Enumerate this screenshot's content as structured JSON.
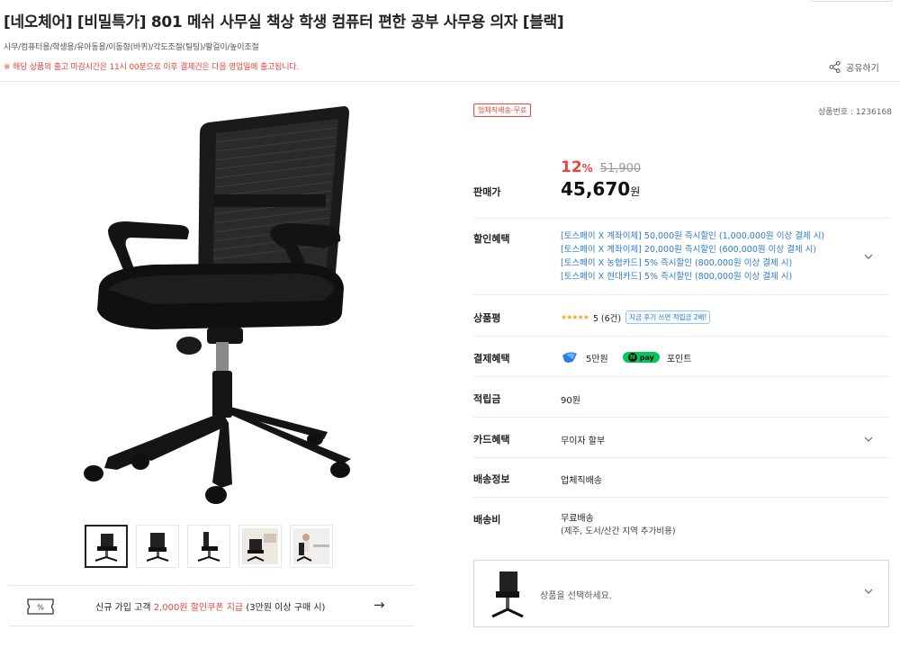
{
  "product": {
    "title": "[네오체어] [비밀특가] 801 메쉬 사무실 책상 학생 컴퓨터 편한 공부 사무용 의자 [블랙]",
    "categories": "사무/컴퓨터용/학생용/유아동용/이동형(바퀴)/각도조절(틸팅)/팔걸이/높이조절",
    "notice": "※ 해당 상품의 출고 마감시간은 11시 00분으로 이후 결제건은 다음 영업일에 출고됩니다.",
    "share_label": "공유하기",
    "badge": "업체직배송-무료",
    "product_number": "상품번호 : 1236168"
  },
  "price": {
    "label": "판매가",
    "discount_pct": "12",
    "pct_sign": "%",
    "original": "51,900",
    "sale": "45,670",
    "won": "원"
  },
  "benefits": {
    "label": "할인혜택",
    "items": [
      "[토스페이 X 계좌이체] 50,000원 즉시할인 (1,000,000원 이상 결제 시)",
      "[토스페이 X 계좌이체] 20,000원 즉시할인 (600,000원 이상 결제 시)",
      "[토스페이 X 농협카드] 5% 즉시할인 (800,000원 이상 결제 시)",
      "[토스페이 X 현대카드] 5% 즉시할인 (800,000원 이상 결제 시)"
    ]
  },
  "review": {
    "label": "상품평",
    "stars": "★★★★★",
    "score": "5 (6건)",
    "tag": "지금 후기 쓰면 적립금 2배!"
  },
  "payment": {
    "label": "결제혜택",
    "toss_amount": "5만원",
    "npay_label": "pay",
    "npay_n": "N",
    "point_label": "포인트"
  },
  "points": {
    "label": "적립금",
    "value": "90원"
  },
  "card": {
    "label": "카드혜택",
    "value": "무이자 할부"
  },
  "shipping_info": {
    "label": "배송정보",
    "value": "업체직배송"
  },
  "shipping_fee": {
    "label": "배송비",
    "value": "무료배송",
    "note": "(제주, 도서/산간 지역 추가비용)"
  },
  "coupon": {
    "prefix": "신규 가입 고객 ",
    "highlight": "2,000원 할인쿠폰 지급",
    "suffix": " (3만원 이상 구매 시)",
    "arrow": "→"
  },
  "select": {
    "placeholder": "상품을 선택하세요."
  },
  "colors": {
    "accent": "#e8453c",
    "link": "#2b7bd6",
    "npay": "#03c75a",
    "star": "#f5a623"
  }
}
